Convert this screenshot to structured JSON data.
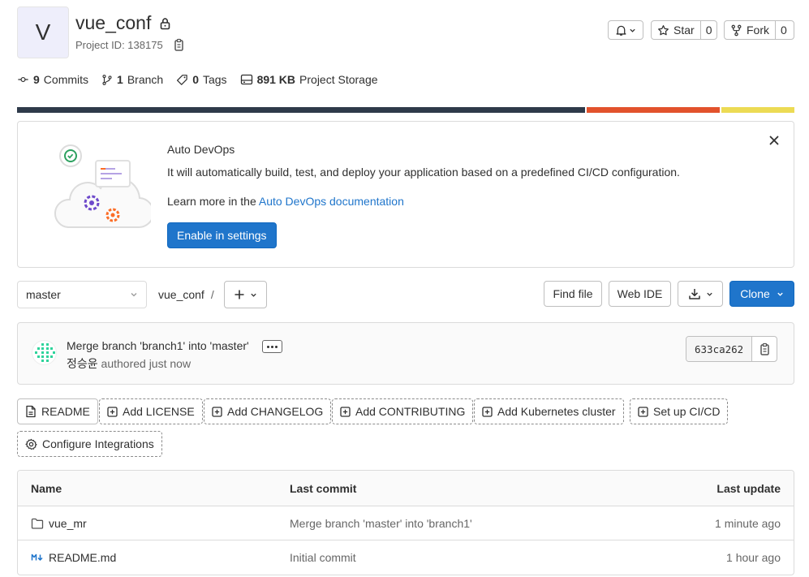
{
  "project": {
    "avatar_letter": "V",
    "name": "vue_conf",
    "id_label": "Project ID: 138175"
  },
  "header_actions": {
    "star_label": "Star",
    "star_count": "0",
    "fork_label": "Fork",
    "fork_count": "0"
  },
  "stats": {
    "commits_count": "9",
    "commits_label": "Commits",
    "branches_count": "1",
    "branches_label": "Branch",
    "tags_count": "0",
    "tags_label": "Tags",
    "storage_size": "891 KB",
    "storage_label": "Project Storage"
  },
  "language_bar": [
    {
      "color": "#2e3a4a",
      "fraction": 0.732
    },
    {
      "color": "#e2522c",
      "fraction": 0.172
    },
    {
      "color": "#ecdb54",
      "fraction": 0.094
    }
  ],
  "auto_devops": {
    "title": "Auto DevOps",
    "description": "It will automatically build, test, and deploy your application based on a predefined CI/CD configuration.",
    "learn_prefix": "Learn more in the ",
    "learn_link": "Auto DevOps documentation",
    "cta": "Enable in settings"
  },
  "repo_nav": {
    "branch": "master",
    "breadcrumb": "vue_conf",
    "breadcrumb_sep": "/",
    "find_file": "Find file",
    "web_ide": "Web IDE",
    "clone": "Clone"
  },
  "last_commit": {
    "message": "Merge branch 'branch1' into 'master'",
    "author": "정승윤",
    "authored": "authored just now",
    "sha": "633ca262"
  },
  "quick_actions": [
    {
      "label": "README",
      "icon": "file-icon",
      "style": "solid"
    },
    {
      "label": "Add LICENSE",
      "icon": "plus-square-icon",
      "style": "dashed"
    },
    {
      "label": "Add CHANGELOG",
      "icon": "plus-square-icon",
      "style": "dashed"
    },
    {
      "label": "Add CONTRIBUTING",
      "icon": "plus-square-icon",
      "style": "dashed"
    },
    {
      "label": "Add Kubernetes cluster",
      "icon": "plus-square-icon",
      "style": "dashed"
    },
    {
      "label": "Set up CI/CD",
      "icon": "plus-square-icon",
      "style": "dashed"
    },
    {
      "label": "Configure Integrations",
      "icon": "settings-icon",
      "style": "dashed"
    }
  ],
  "file_table": {
    "headers": {
      "name": "Name",
      "last_commit": "Last commit",
      "last_update": "Last update"
    },
    "rows": [
      {
        "name": "vue_mr",
        "icon": "folder-icon",
        "commit": "Merge branch 'master' into 'branch1'",
        "updated": "1 minute ago"
      },
      {
        "name": "README.md",
        "icon": "markdown-icon",
        "commit": "Initial commit",
        "updated": "1 hour ago"
      }
    ]
  }
}
